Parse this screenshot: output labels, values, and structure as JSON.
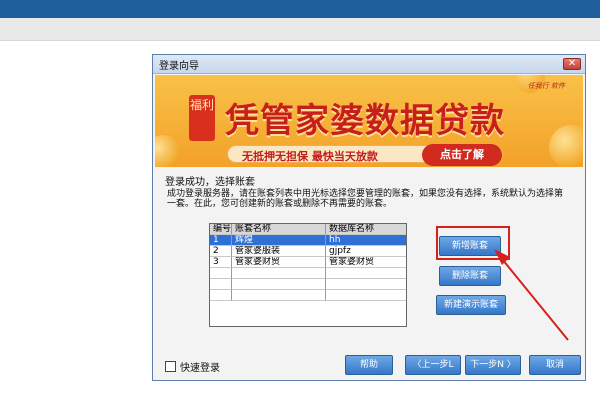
{
  "dialog": {
    "title": "登录向导",
    "close_glyph": "✕"
  },
  "banner": {
    "badge": "福利",
    "headline": "凭管家婆数据贷款",
    "tagline": "无抵押无担保  最快当天放款",
    "cta": "点击了解",
    "brand": "任我行 软件"
  },
  "content": {
    "step_text": "登录成功，选择账套",
    "description": "成功登录服务器，请在账套列表中用光标选择您要管理的账套，如果您没有选择，系统默认为选择第一套。在此，您可创建新的账套或删除不再需要的账套。"
  },
  "table": {
    "headers": [
      "编号",
      "账套名称",
      "数据库名称"
    ],
    "rows": [
      [
        "1",
        "辉煌",
        "hh"
      ],
      [
        "2",
        "管家婆服装",
        "gjpfz"
      ],
      [
        "3",
        "管家婆财贸",
        "管家婆财贸"
      ]
    ],
    "selected_index": 0
  },
  "side_buttons": {
    "new": "新增账套",
    "delete": "删除账套",
    "new_demo": "新建演示账套"
  },
  "footer": {
    "quick_login": "快速登录",
    "help": "帮助",
    "prev": "〈上一步L",
    "next": "下一步N 〉",
    "cancel": "取消"
  },
  "colors": {
    "highlight_red": "#d6201b",
    "selection_blue": "#2f6fd6",
    "button_blue": "#3577c8"
  }
}
